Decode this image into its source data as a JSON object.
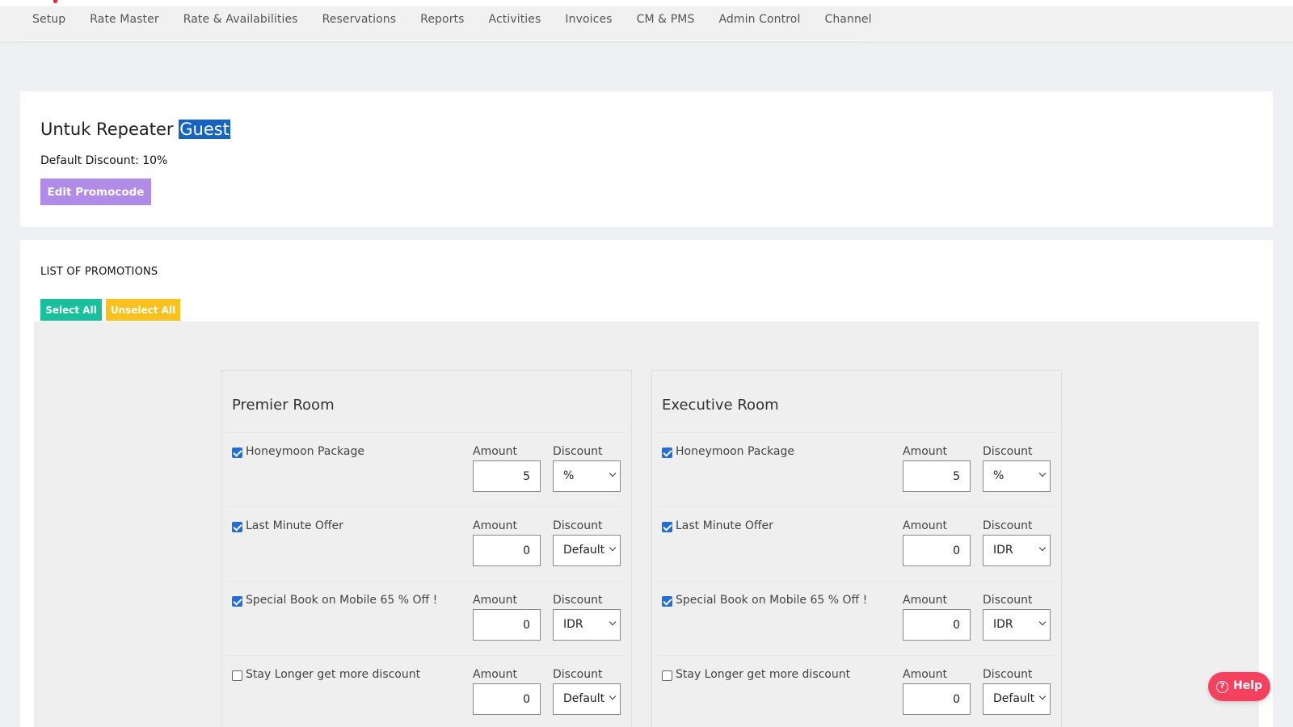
{
  "nav": {
    "items": [
      {
        "label": "Setup"
      },
      {
        "label": "Rate Master"
      },
      {
        "label": "Rate & Availabilities"
      },
      {
        "label": "Reservations"
      },
      {
        "label": "Reports"
      },
      {
        "label": "Activities"
      },
      {
        "label": "Invoices"
      },
      {
        "label": "CM & PMS"
      },
      {
        "label": "Admin Control"
      },
      {
        "label": "Channel"
      }
    ]
  },
  "promo": {
    "title_prefix": "Untuk Repeater",
    "title_selected": "Guest",
    "default_discount": "Default Discount: 10%",
    "edit_button": "Edit Promocode"
  },
  "promotions": {
    "title": "LIST OF PROMOTIONS",
    "select_all": "Select All",
    "unselect_all": "Unselect All"
  },
  "labels": {
    "amount": "Amount",
    "discount": "Discount"
  },
  "rooms": [
    {
      "name": "Premier Room",
      "items": [
        {
          "name": "Honeymoon Package",
          "checked": true,
          "amount": "5",
          "discount": "%"
        },
        {
          "name": "Last Minute Offer",
          "checked": true,
          "amount": "0",
          "discount": "Default"
        },
        {
          "name": "Special Book on Mobile 65 % Off !",
          "checked": true,
          "amount": "0",
          "discount": "IDR"
        },
        {
          "name": "Stay Longer get more discount",
          "checked": false,
          "amount": "0",
          "discount": "Default"
        }
      ]
    },
    {
      "name": "Executive Room",
      "items": [
        {
          "name": "Honeymoon Package",
          "checked": true,
          "amount": "5",
          "discount": "%"
        },
        {
          "name": "Last Minute Offer",
          "checked": true,
          "amount": "0",
          "discount": "IDR"
        },
        {
          "name": "Special Book on Mobile 65 % Off !",
          "checked": true,
          "amount": "0",
          "discount": "IDR"
        },
        {
          "name": "Stay Longer get more discount",
          "checked": false,
          "amount": "0",
          "discount": "Default"
        }
      ]
    }
  ],
  "help": {
    "label": "Help",
    "icon": "question-circle-icon"
  },
  "colors": {
    "edit_button": "#b18be8",
    "select_all": "#17c19b",
    "unselect_all": "#fcc21b",
    "help": "#f5405e",
    "checkbox": "#1e6fd9",
    "selection": "#1565c0"
  }
}
